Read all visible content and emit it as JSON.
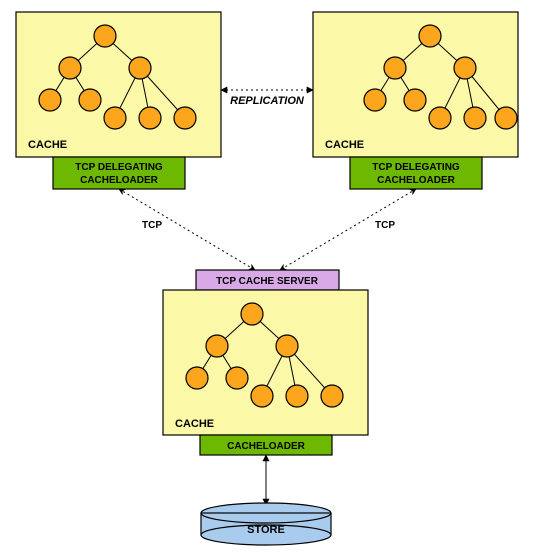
{
  "diagram": {
    "cache_left": {
      "label": "CACHE"
    },
    "cache_right": {
      "label": "CACHE"
    },
    "cache_server": {
      "label": "CACHE"
    },
    "replication": "REPLICATION",
    "tcp_left": "TCP",
    "tcp_right": "TCP",
    "delegating_left_line1": "TCP DELEGATING",
    "delegating_left_line2": "CACHELOADER",
    "delegating_right_line1": "TCP DELEGATING",
    "delegating_right_line2": "CACHELOADER",
    "tcp_cache_server": "TCP CACHE SERVER",
    "cacheloader": "CACHELOADER",
    "store": "STORE"
  }
}
